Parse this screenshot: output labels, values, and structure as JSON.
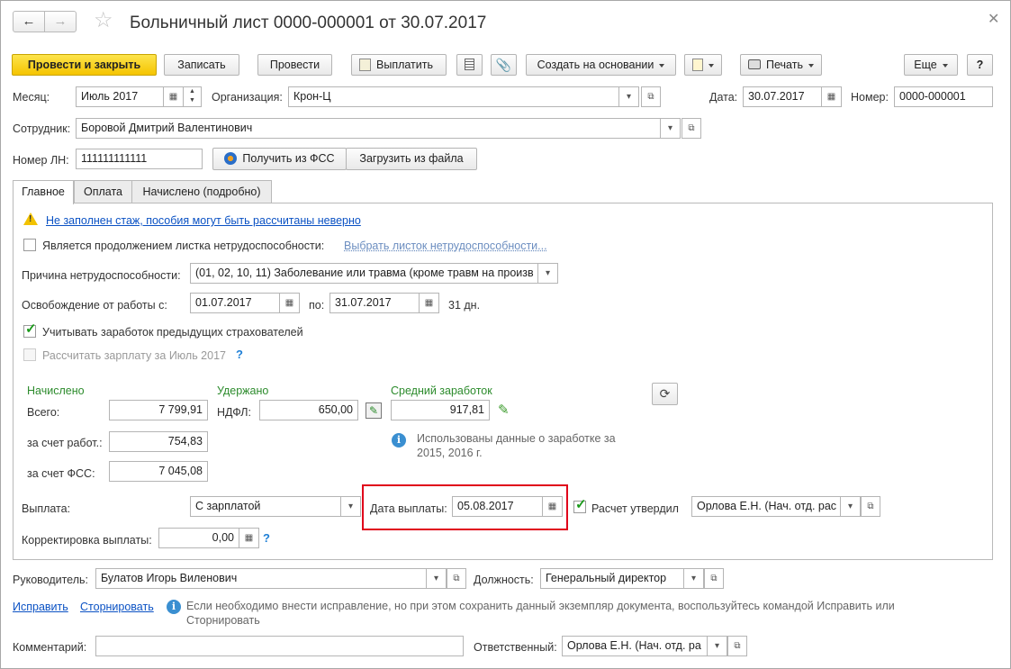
{
  "title": "Больничный лист 0000-000001 от 30.07.2017",
  "toolbar": {
    "post_close": "Провести и закрыть",
    "save": "Записать",
    "post": "Провести",
    "pay": "Выплатить",
    "create_based": "Создать на основании",
    "print": "Печать",
    "more": "Еще",
    "help": "?"
  },
  "header": {
    "month_label": "Месяц:",
    "month_value": "Июль 2017",
    "org_label": "Организация:",
    "org_value": "Крон-Ц",
    "date_label": "Дата:",
    "date_value": "30.07.2017",
    "number_label": "Номер:",
    "number_value": "0000-000001",
    "employee_label": "Сотрудник:",
    "employee_value": "Боровой Дмитрий Валентинович",
    "ln_label": "Номер ЛН:",
    "ln_value": "111111111111",
    "fss_button": "Получить из ФСС",
    "file_button": "Загрузить из файла"
  },
  "tabs": [
    "Главное",
    "Оплата",
    "Начислено (подробно)"
  ],
  "main": {
    "warning": "Не заполнен стаж, пособия могут быть рассчитаны неверно",
    "continuation_label": "Является продолжением листка нетрудоспособности:",
    "continuation_link": "Выбрать листок нетрудоспособности...",
    "reason_label": "Причина нетрудоспособности:",
    "reason_value": "(01, 02, 10, 11) Заболевание или травма (кроме травм на произв",
    "release_label": "Освобождение от работы с:",
    "release_from": "01.07.2017",
    "release_to_label": "по:",
    "release_to": "31.07.2017",
    "days": "31 дн.",
    "prev_insurers_label": "Учитывать заработок предыдущих страхователей",
    "prev_insurers_checked": true,
    "calc_salary_label": "Рассчитать зарплату за Июль 2017",
    "calc_salary_checked": false,
    "help_mark": "?",
    "accrued_header": "Начислено",
    "total_label": "Всего:",
    "total_value": "7 799,91",
    "employer_label": "за счет работ.:",
    "employer_value": "754,83",
    "fss_label": "за счет ФСС:",
    "fss_value": "7 045,08",
    "withheld_header": "Удержано",
    "ndfl_label": "НДФЛ:",
    "ndfl_value": "650,00",
    "avg_header": "Средний заработок",
    "avg_value": "917,81",
    "avg_info": "Использованы данные о заработке за 2015,  2016 г.",
    "payment_label": "Выплата:",
    "payment_value": "С зарплатой",
    "pay_date_label": "Дата выплаты:",
    "pay_date_value": "05.08.2017",
    "approved_label": "Расчет утвердил",
    "approved_checked": true,
    "approved_value": "Орлова Е.Н. (Нач. отд. рас",
    "correction_label": "Корректировка выплаты:",
    "correction_value": "0,00"
  },
  "footer": {
    "head_label": "Руководитель:",
    "head_value": "Булатов Игорь Виленович",
    "position_label": "Должность:",
    "position_value": "Генеральный директор",
    "fix_link": "Исправить",
    "reverse_link": "Сторнировать",
    "fix_info": "Если необходимо внести исправление, но при этом сохранить данный экземпляр документа, воспользуйтесь командой Исправить или Сторнировать",
    "comment_label": "Комментарий:",
    "comment_value": "",
    "responsible_label": "Ответственный:",
    "responsible_value": "Орлова Е.Н. (Нач. отд. ра"
  },
  "colors": {
    "accent_yellow": "#f5c400",
    "highlight_red": "#e0001a",
    "link_blue": "#0b52c4",
    "green_header": "#2c8b2c"
  }
}
